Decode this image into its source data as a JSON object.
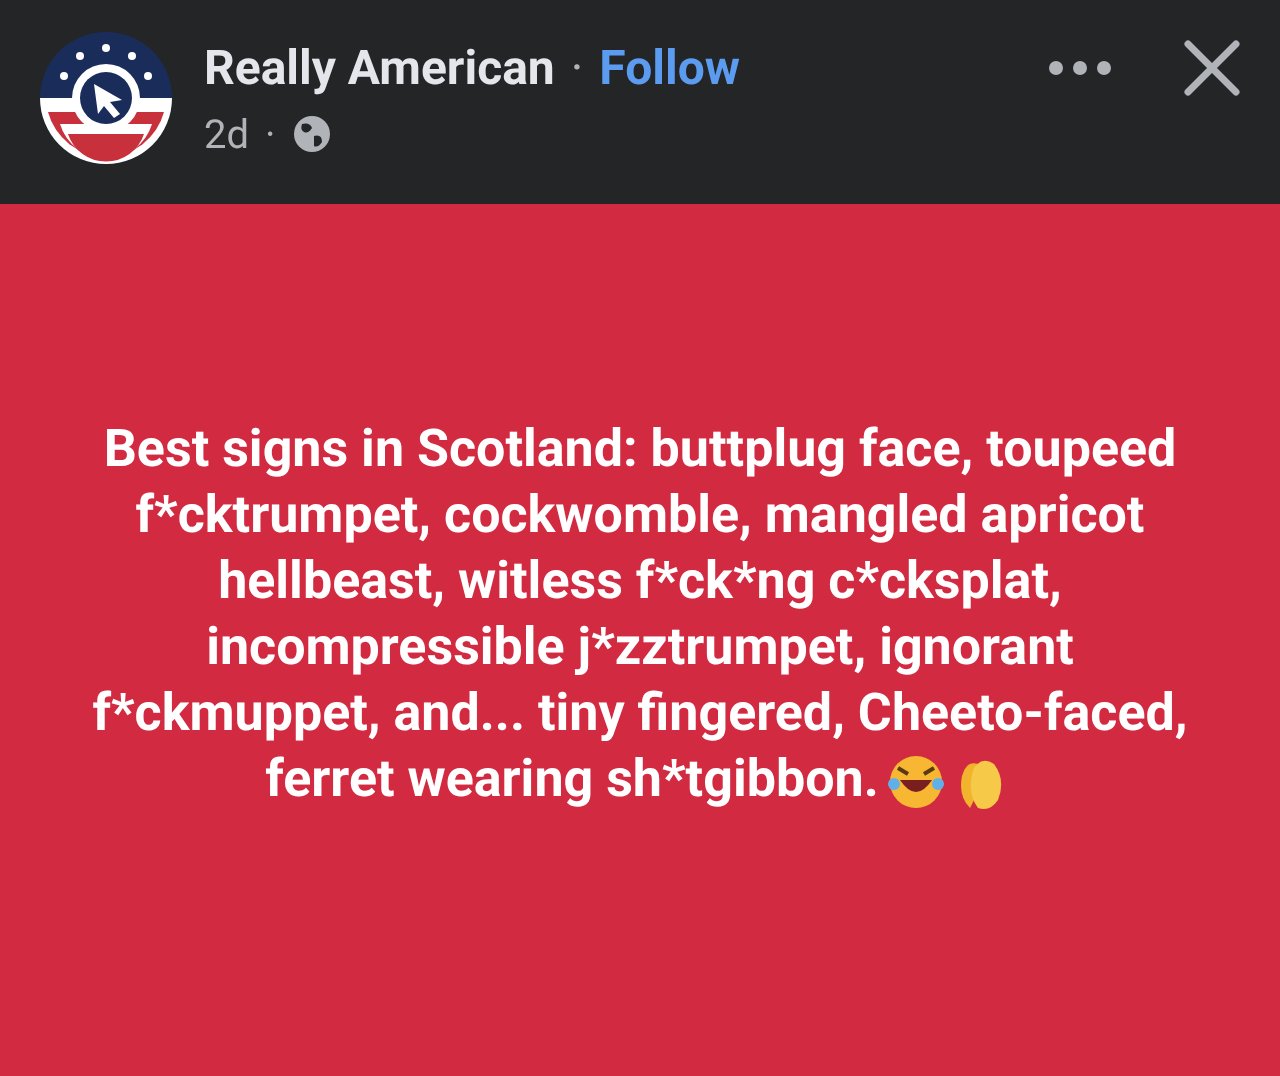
{
  "post": {
    "author": "Really American",
    "separator": "·",
    "follow": "Follow",
    "time": "2d",
    "time_separator": "·"
  },
  "message": "Best signs in Scotland: buttplug face, toupeed f*cktrumpet, cockwomble, mangled apricot hellbeast, witless f*ck*ng c*cksplat, incompressible j*zztrumpet, ignorant f*ckmuppet, and... tiny fingered, Cheeto-faced,",
  "message_end": "ferret wearing sh*tgibbon."
}
